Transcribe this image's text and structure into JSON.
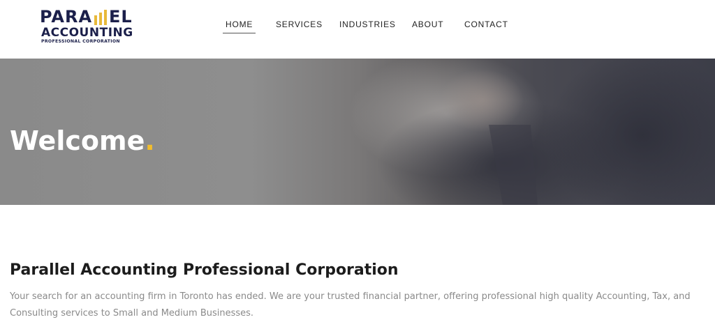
{
  "logo": {
    "line1_left": "PARA",
    "line1_right": "EL",
    "line2": "ACCOUNTING",
    "line3": "PROFESSIONAL CORPORATION",
    "accent_color": "#e8b93a",
    "brand_color": "#1b1f4a"
  },
  "nav": {
    "items": [
      {
        "label": "HOME",
        "active": true
      },
      {
        "label": "SERVICES",
        "active": false
      },
      {
        "label": "INDUSTRIES",
        "active": false
      },
      {
        "label": "ABOUT",
        "active": false
      },
      {
        "label": "CONTACT",
        "active": false
      }
    ]
  },
  "hero": {
    "title": "Welcome",
    "title_dot": ".",
    "dot_color": "#f2bd2c"
  },
  "intro": {
    "heading": "Parallel Accounting Professional Corporation",
    "body": "Your search for an accounting firm in Toronto has ended. We are your trusted financial partner, offering professional high quality Accounting, Tax, and Consulting services to Small and Medium Businesses."
  }
}
